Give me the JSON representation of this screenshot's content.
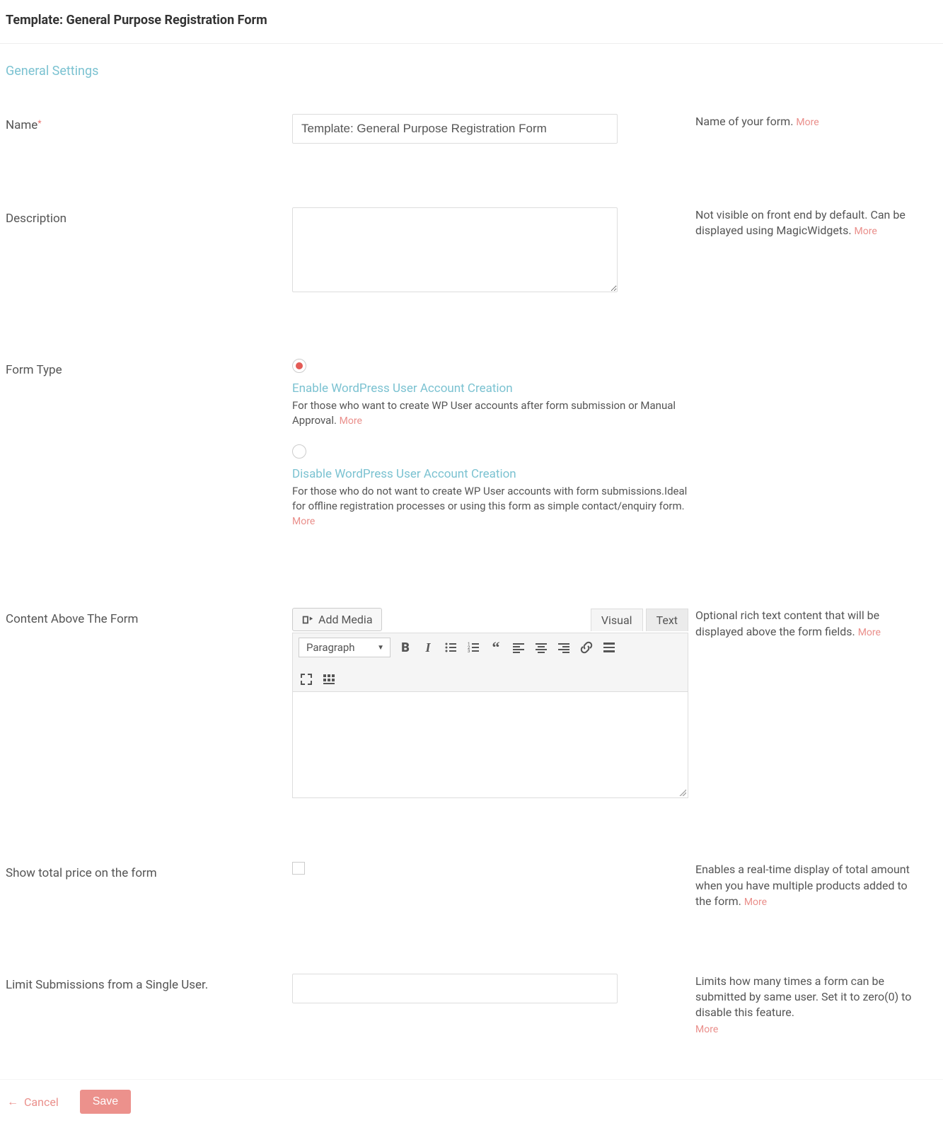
{
  "header": {
    "title": "Template: General Purpose Registration Form"
  },
  "section": {
    "title": "General Settings"
  },
  "fields": {
    "name": {
      "label": "Name",
      "value": "Template: General Purpose Registration Form",
      "help": "Name of your form.",
      "more": "More"
    },
    "description": {
      "label": "Description",
      "value": "",
      "help": "Not visible on front end by default. Can be displayed using MagicWidgets.",
      "more": "More"
    },
    "form_type": {
      "label": "Form Type",
      "options": [
        {
          "title": "Enable WordPress User Account Creation",
          "desc": "For those who want to create WP User accounts after form submission or Manual Approval.",
          "more": "More",
          "checked": true
        },
        {
          "title": "Disable WordPress User Account Creation",
          "desc": "For those who do not want to create WP User accounts with form submissions.Ideal for offline registration processes or using this form as simple contact/enquiry form.",
          "more": "More",
          "checked": false
        }
      ]
    },
    "content_above": {
      "label": "Content Above The Form",
      "add_media": "Add Media",
      "tabs": {
        "visual": "Visual",
        "text": "Text"
      },
      "format": "Paragraph",
      "help": "Optional rich text content that will be displayed above the form fields.",
      "more": "More"
    },
    "show_total": {
      "label": "Show total price on the form",
      "checked": false,
      "help": "Enables a real-time display of total amount when you have multiple products added to the form.",
      "more": "More"
    },
    "limit_submissions": {
      "label": "Limit Submissions from a Single User.",
      "value": "",
      "help": "Limits how many times a form can be submitted by same user. Set it to zero(0) to disable this feature.",
      "more": "More"
    }
  },
  "footer": {
    "cancel": "Cancel",
    "save": "Save"
  }
}
